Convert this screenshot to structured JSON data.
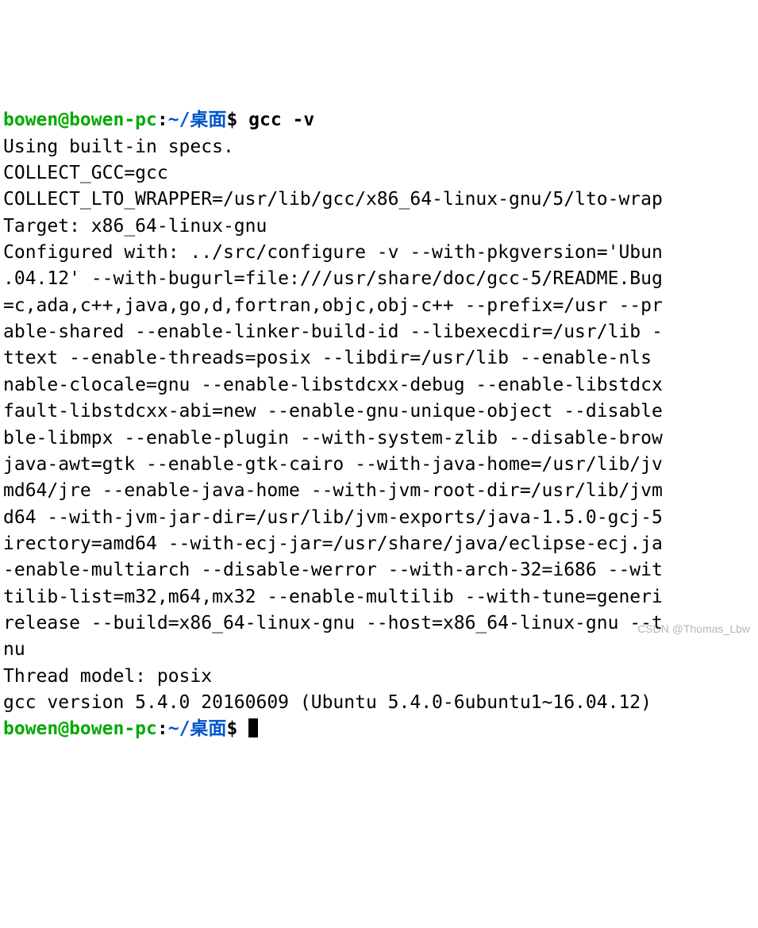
{
  "prompt1": {
    "user": "bowen@bowen-pc",
    "sep": ":",
    "path": "~/桌面",
    "dollar": "$ ",
    "command": "gcc -v"
  },
  "output_lines": [
    "Using built-in specs.",
    "COLLECT_GCC=gcc",
    "COLLECT_LTO_WRAPPER=/usr/lib/gcc/x86_64-linux-gnu/5/lto-wrap",
    "Target: x86_64-linux-gnu",
    "Configured with: ../src/configure -v --with-pkgversion='Ubun",
    ".04.12' --with-bugurl=file:///usr/share/doc/gcc-5/README.Bug",
    "=c,ada,c++,java,go,d,fortran,objc,obj-c++ --prefix=/usr --pr",
    "able-shared --enable-linker-build-id --libexecdir=/usr/lib -",
    "ttext --enable-threads=posix --libdir=/usr/lib --enable-nls ",
    "nable-clocale=gnu --enable-libstdcxx-debug --enable-libstdcx",
    "fault-libstdcxx-abi=new --enable-gnu-unique-object --disable",
    "ble-libmpx --enable-plugin --with-system-zlib --disable-brow",
    "java-awt=gtk --enable-gtk-cairo --with-java-home=/usr/lib/jv",
    "md64/jre --enable-java-home --with-jvm-root-dir=/usr/lib/jvm",
    "d64 --with-jvm-jar-dir=/usr/lib/jvm-exports/java-1.5.0-gcj-5",
    "irectory=amd64 --with-ecj-jar=/usr/share/java/eclipse-ecj.ja",
    "-enable-multiarch --disable-werror --with-arch-32=i686 --wit",
    "tilib-list=m32,m64,mx32 --enable-multilib --with-tune=generi",
    "release --build=x86_64-linux-gnu --host=x86_64-linux-gnu --t",
    "nu",
    "Thread model: posix",
    "gcc version 5.4.0 20160609 (Ubuntu 5.4.0-6ubuntu1~16.04.12) "
  ],
  "prompt2": {
    "user": "bowen@bowen-pc",
    "sep": ":",
    "path": "~/桌面",
    "dollar": "$ "
  },
  "watermark": "CSDN @Thomas_Lbw"
}
